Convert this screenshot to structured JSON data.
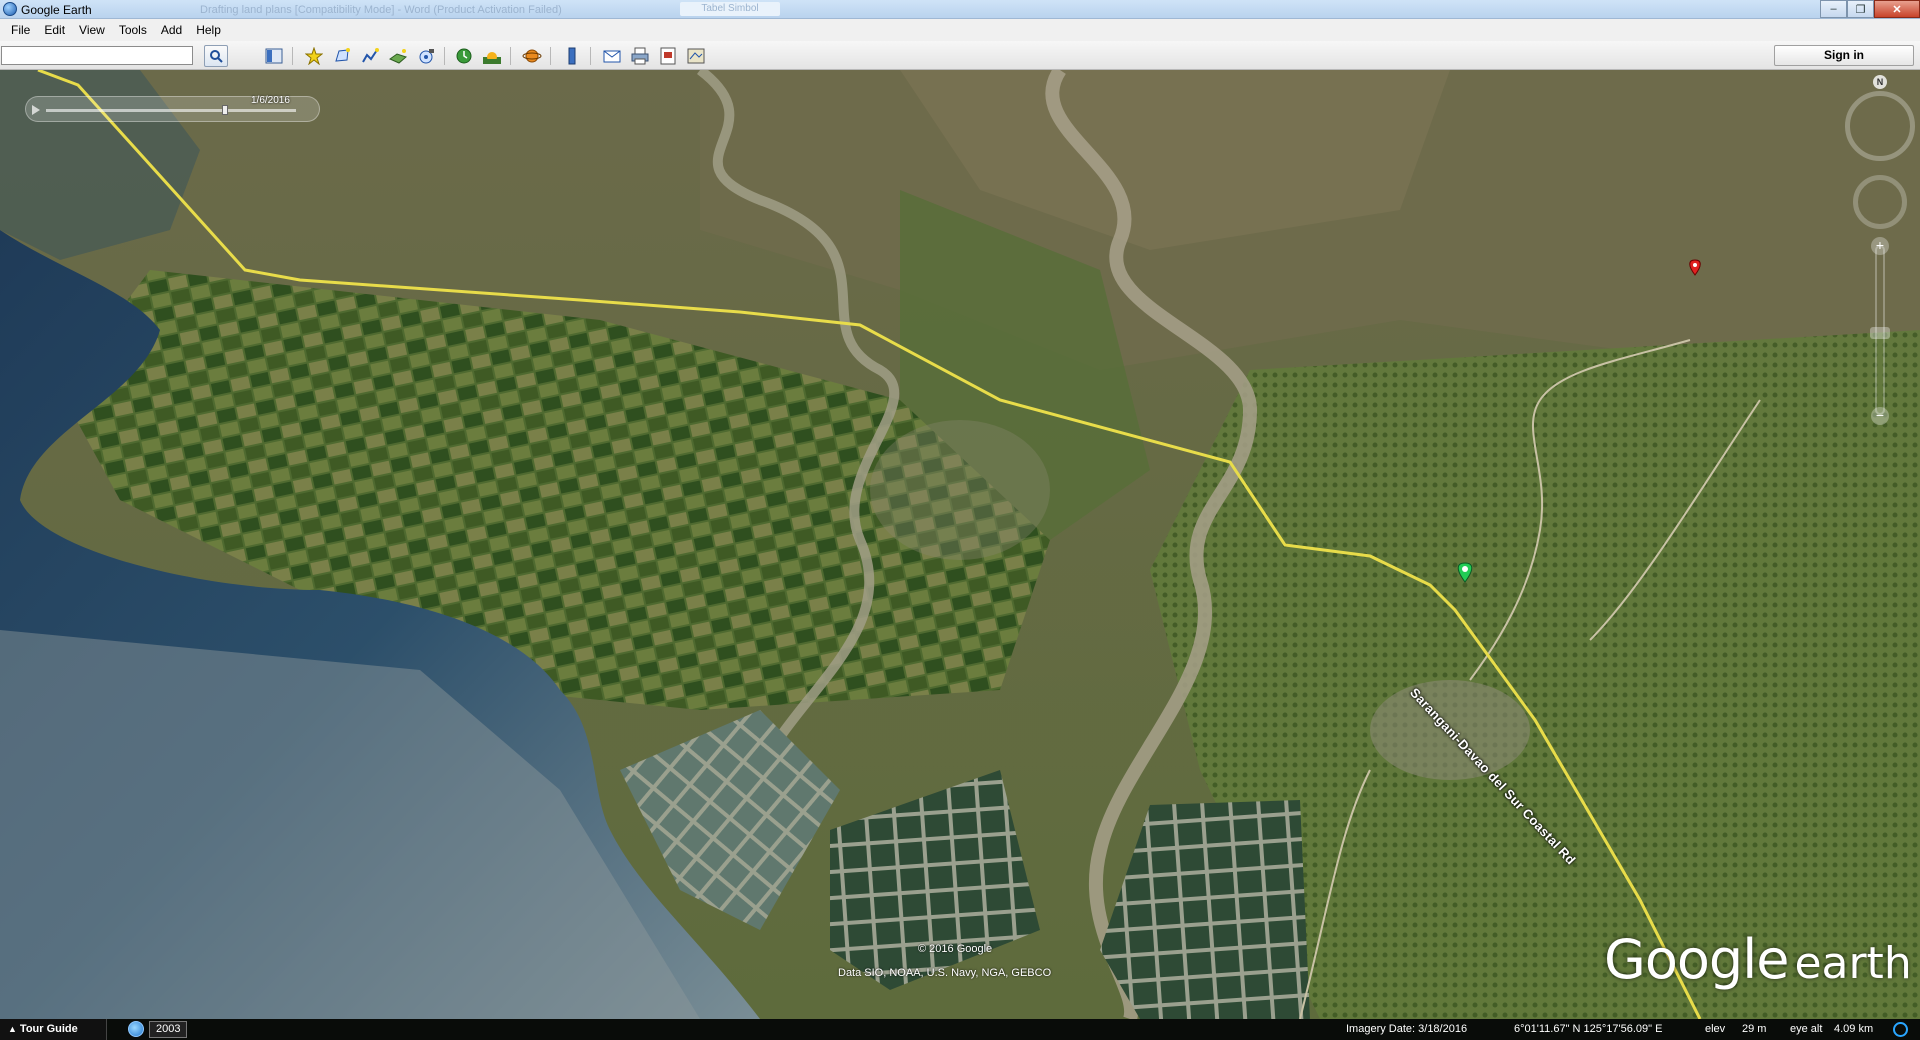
{
  "window": {
    "title": "Google Earth",
    "ghost_tab": "Drafting land plans [Compatibility Mode] - Word (Product Activation Failed)",
    "ghost_button": "Tabel Simbol",
    "minimize": "–",
    "maximize": "❐",
    "close": "✕"
  },
  "menu": [
    {
      "label": "File"
    },
    {
      "label": "Edit"
    },
    {
      "label": "View"
    },
    {
      "label": "Tools"
    },
    {
      "label": "Add"
    },
    {
      "label": "Help"
    }
  ],
  "toolbar": {
    "search_value": "",
    "search_placeholder": "",
    "signin_label": "Sign in",
    "icons": [
      "sidebar-toggle-icon",
      "placemark-icon",
      "polygon-icon",
      "path-icon",
      "image-overlay-icon",
      "record-tour-icon",
      "historical-imagery-icon",
      "sunlight-icon",
      "planets-icon",
      "ruler-icon",
      "email-icon",
      "print-icon",
      "save-image-icon",
      "view-in-maps-icon"
    ]
  },
  "map": {
    "time_slider_date": "1/6/2016",
    "compass_label": "N",
    "road_label": "Sarangani-Davao del Sur Coastal Rd",
    "copyright": "© 2016 Google",
    "data_sources": "Data SIO, NOAA, U.S. Navy, NGA, GEBCO",
    "logo_google": "Google",
    "logo_earth": "earth",
    "placemark_green_color": "#22cc55",
    "placemark_red_color": "#e02020",
    "path_color": "#e8dc4a"
  },
  "status": {
    "tour_guide": "Tour Guide",
    "historical_year": "2003",
    "imagery_date": "Imagery Date: 3/18/2016",
    "coordinates": "6°01'11.67\" N  125°17'56.09\" E",
    "elev_label": "elev",
    "elev_value": "29 m",
    "eye_alt_label": "eye alt",
    "eye_alt_value": "4.09 km"
  }
}
